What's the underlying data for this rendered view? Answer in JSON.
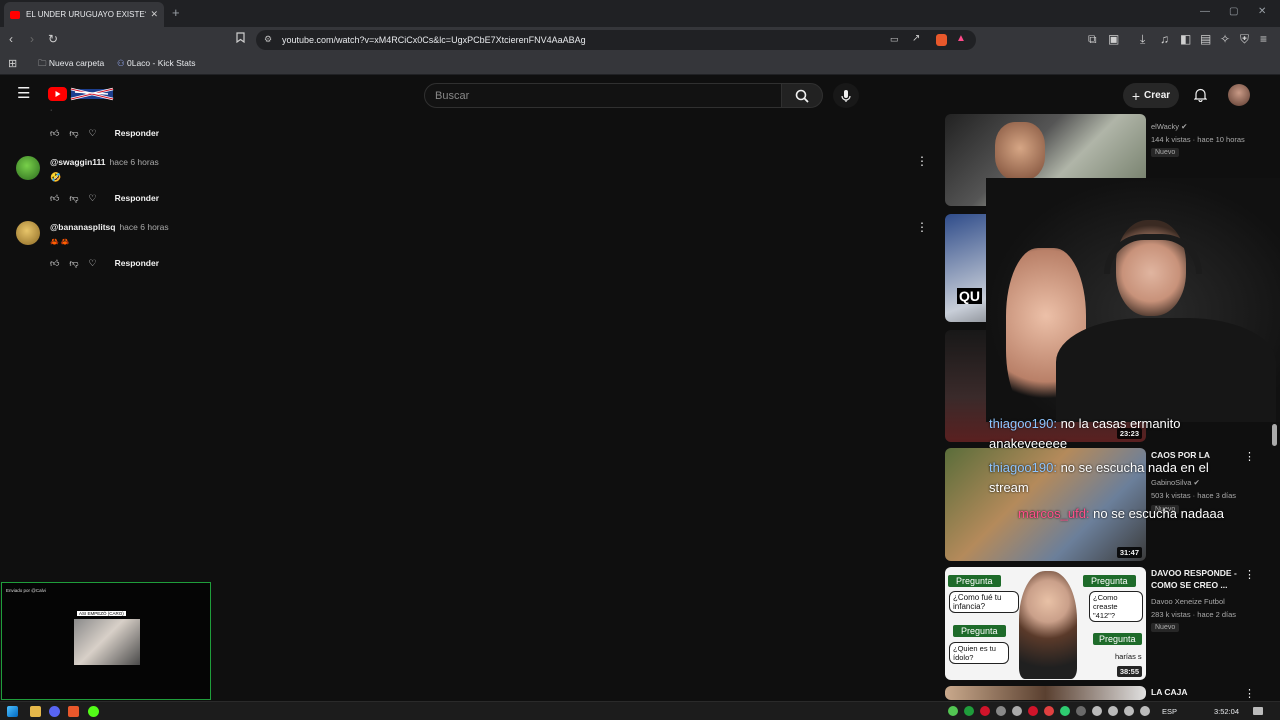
{
  "browser": {
    "tab_title": "EL UNDER URUGUAYO EXISTE? |",
    "url": "youtube.com/watch?v=xM4RCiCx0Cs&lc=UgxPCbE7XtcierenFNV4AaABAg",
    "bookmarks": [
      "Nueva carpeta",
      "0Laco - Kick Stats"
    ]
  },
  "youtube": {
    "search_placeholder": "Buscar",
    "create_label": "Crear"
  },
  "comments": [
    {
      "user": "@swaggin111",
      "time": "hace 6 horas",
      "body": "🤣",
      "reply": "Responder"
    },
    {
      "user": "@bananasplitsq",
      "time": "hace 6 horas",
      "body": "🦀 🦀",
      "reply": "Responder"
    }
  ],
  "top_reply_label": "Responder",
  "sidebar": [
    {
      "title": "",
      "channel": "elWacky",
      "meta": "144 k vistas · hace 10 horas",
      "badge": "Nuevo",
      "duration": ""
    },
    {
      "title": "",
      "channel": "",
      "meta": "",
      "badge": "",
      "duration": ""
    },
    {
      "title": "",
      "channel": "",
      "meta": "",
      "badge": "",
      "duration": "23:23"
    },
    {
      "title": "CAOS POR LA",
      "channel": "GabinoSilva",
      "meta": "503 k vistas · hace 3 días",
      "badge": "Nuevo",
      "duration": "31:47"
    },
    {
      "title": "DAVOO RESPONDE - COMO SE CREO ...",
      "channel": "Davoo Xeneize Futbol",
      "meta": "283 k vistas · hace 2 días",
      "badge": "Nuevo",
      "duration": "38:55"
    },
    {
      "title": "LA CAJA",
      "channel": "",
      "meta": "",
      "badge": "",
      "duration": ""
    }
  ],
  "overlay_chat": [
    {
      "user": "thiagoo190:",
      "text": " no la casas ermanito"
    },
    {
      "user": "",
      "text": "anakeveeeee"
    },
    {
      "user": "thiagoo190:",
      "text": " no se escucha nada en el"
    },
    {
      "user": "",
      "text": "stream"
    },
    {
      "user": "marcos_ufd:",
      "text": " no se escucha nadaaa"
    }
  ],
  "thumb_text": {
    "pregunta": "Pregunta",
    "q1": "¿Como fué tu infancia?",
    "q2": "¿Como creaste \"412\"?",
    "q3": "¿Quien es tu ídolo?",
    "q4": "harías s"
  },
  "mini_player": {
    "header": "Enviado por @Calvi",
    "caption": "ASI EMPEZÓ (CARO)"
  },
  "taskbar": {
    "lang": "ESP",
    "time": "3:52:04"
  },
  "colors": {
    "yt_red": "#ff0000",
    "bg": "#0f0f0f",
    "verified": "#aaaaaa"
  }
}
